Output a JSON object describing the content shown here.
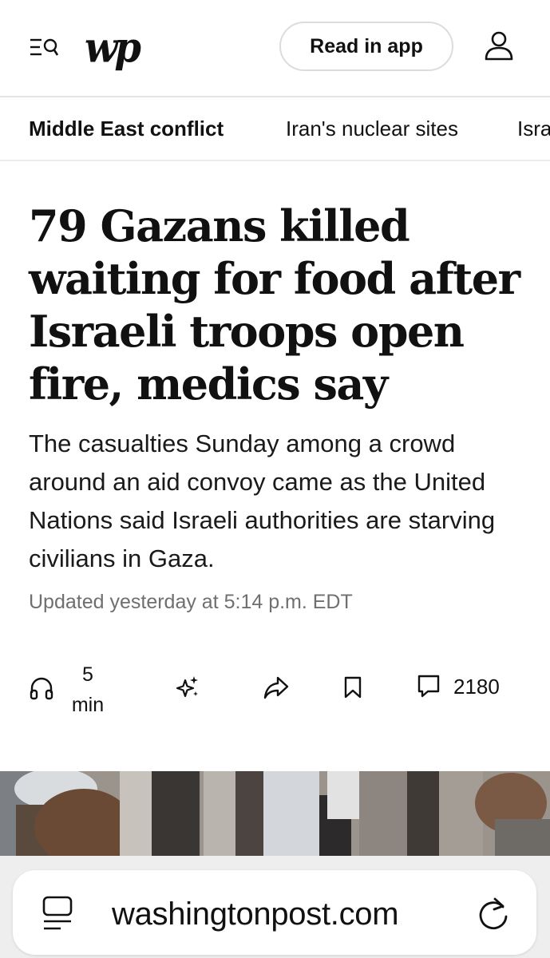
{
  "header": {
    "logo_text": "wp",
    "read_in_app_label": "Read in app",
    "menu_icon": "menu-search-icon",
    "profile_icon": "user-icon"
  },
  "topics": [
    {
      "label": "Middle East conflict",
      "active": true
    },
    {
      "label": "Iran's nuclear sites",
      "active": false
    },
    {
      "label": "Isra",
      "active": false
    }
  ],
  "article": {
    "headline": "79 Gazans killed waiting for food after Israeli troops open fire, medics say",
    "dek": "The casualties Sunday among a crowd around an aid convoy came as the United Nations said Israeli authorities are starving civilians in Gaza.",
    "timestamp": "Updated yesterday at 5:14 p.m. EDT"
  },
  "actions": {
    "listen_minutes": "5",
    "listen_unit": "min",
    "comments_count": "2180",
    "icons": [
      "headphones-icon",
      "sparkle-icon",
      "share-icon",
      "bookmark-icon",
      "comment-icon"
    ]
  },
  "browser": {
    "url": "washingtonpost.com",
    "reader_icon": "reader-icon",
    "reload_icon": "reload-icon"
  },
  "colors": {
    "text": "#111111",
    "muted": "#6f6f6f",
    "divider": "#e4e4e4",
    "browser_bg": "#eeeeee"
  }
}
